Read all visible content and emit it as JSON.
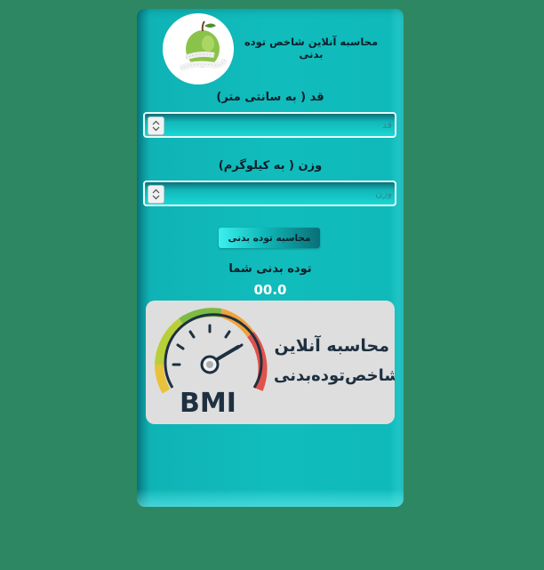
{
  "header": {
    "title": "محاسبه آنلاین شاخص توده بدنی",
    "logo_icon": "apple-measuring-tape-icon"
  },
  "height_field": {
    "label": "قد ( به سانتی متر)",
    "placeholder": "قد",
    "value": ""
  },
  "weight_field": {
    "label": "وزن ( به کیلوگرم)",
    "placeholder": "وزن",
    "value": ""
  },
  "calculate_button": {
    "label": "محاسبه توده بدنی"
  },
  "result": {
    "label": "توده بدنی شما",
    "value": "00.0"
  },
  "banner": {
    "line1": "محاسبه آنلاین",
    "line2": "شاخص‌توده‌بدنی",
    "gauge_text": "BMI",
    "gauge_icon": "bmi-gauge-icon"
  },
  "colors": {
    "page_background": "#2e8763",
    "card": "#11bcbc",
    "banner_background": "#dedede",
    "banner_text": "#1e3040"
  }
}
